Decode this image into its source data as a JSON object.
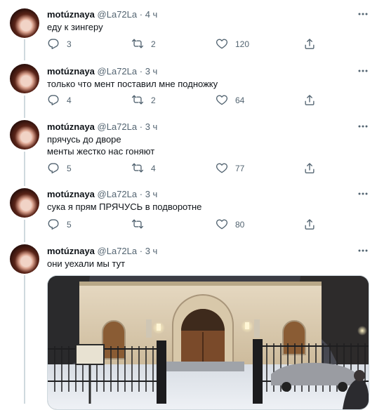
{
  "tweets": [
    {
      "name": "motúznaya",
      "handle": "@La72La",
      "dot": "·",
      "time": "4 ч",
      "text": "еду к зингеру",
      "reply_count": "3",
      "retweet_count": "2",
      "like_count": "120"
    },
    {
      "name": "motúznaya",
      "handle": "@La72La",
      "dot": "·",
      "time": "3 ч",
      "text": "только что мент поставил мне подножку",
      "reply_count": "4",
      "retweet_count": "2",
      "like_count": "64"
    },
    {
      "name": "motúznaya",
      "handle": "@La72La",
      "dot": "·",
      "time": "3 ч",
      "text": "прячусь до дворе\nменты жестко нас гоняют",
      "reply_count": "5",
      "retweet_count": "4",
      "like_count": "77"
    },
    {
      "name": "motúznaya",
      "handle": "@La72La",
      "dot": "·",
      "time": "3 ч",
      "text": "сука я прям ПРЯЧУСЬ в подворотне",
      "reply_count": "5",
      "retweet_count": "",
      "like_count": "80"
    },
    {
      "name": "motúznaya",
      "handle": "@La72La",
      "dot": "·",
      "time": "3 ч",
      "text": "они уехали мы тут",
      "reply_count": "",
      "retweet_count": "",
      "like_count": ""
    }
  ],
  "icons": {
    "reply": "reply-icon",
    "retweet": "retweet-icon",
    "like": "heart-icon",
    "share": "share-icon",
    "more": "more-icon"
  },
  "colors": {
    "text": "#0f1419",
    "secondary": "#536471",
    "thread_line": "#cfd9de"
  }
}
